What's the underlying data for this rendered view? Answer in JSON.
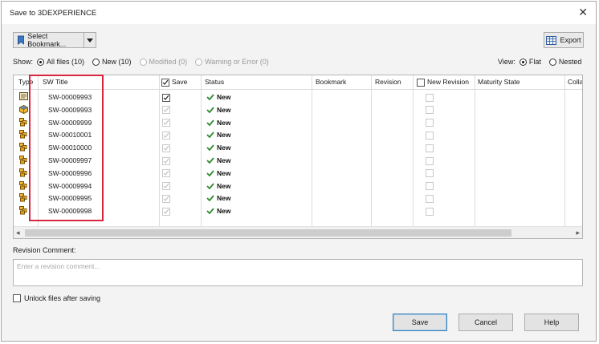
{
  "window": {
    "title": "Save to 3DEXPERIENCE",
    "close_glyph": "✕"
  },
  "toolbar": {
    "bookmark_label": "Select Bookmark...",
    "export_label": "Export"
  },
  "show_filter": {
    "label": "Show:",
    "options": [
      {
        "label": "All files (10)",
        "selected": true,
        "enabled": true
      },
      {
        "label": "New (10)",
        "selected": false,
        "enabled": true
      },
      {
        "label": "Modified (0)",
        "selected": false,
        "enabled": false
      },
      {
        "label": "Warning or Error (0)",
        "selected": false,
        "enabled": false
      }
    ]
  },
  "view_filter": {
    "label": "View:",
    "options": [
      {
        "label": "Flat",
        "selected": true
      },
      {
        "label": "Nested",
        "selected": false
      }
    ]
  },
  "grid": {
    "columns": [
      "Type",
      "SW Title",
      "Save",
      "Status",
      "Bookmark",
      "Revision",
      "New Revision",
      "Maturity State",
      "Colla"
    ],
    "rows": [
      {
        "icon": "drawing-icon",
        "title": "SW-00009993",
        "save_enabled": true,
        "status": "New"
      },
      {
        "icon": "part-icon",
        "title": "SW-00009993",
        "save_enabled": false,
        "status": "New"
      },
      {
        "icon": "assembly-icon",
        "title": "SW-00009999",
        "save_enabled": false,
        "status": "New"
      },
      {
        "icon": "assembly-icon",
        "title": "SW-00010001",
        "save_enabled": false,
        "status": "New"
      },
      {
        "icon": "assembly-icon",
        "title": "SW-00010000",
        "save_enabled": false,
        "status": "New"
      },
      {
        "icon": "assembly-icon",
        "title": "SW-00009997",
        "save_enabled": false,
        "status": "New"
      },
      {
        "icon": "assembly-icon",
        "title": "SW-00009996",
        "save_enabled": false,
        "status": "New"
      },
      {
        "icon": "assembly-icon",
        "title": "SW-00009994",
        "save_enabled": false,
        "status": "New"
      },
      {
        "icon": "assembly-icon",
        "title": "SW-00009995",
        "save_enabled": false,
        "status": "New"
      },
      {
        "icon": "assembly-icon",
        "title": "SW-00009998",
        "save_enabled": false,
        "status": "New"
      }
    ]
  },
  "revision": {
    "label": "Revision Comment:",
    "placeholder": "Enter a revision comment..."
  },
  "unlock_label": "Unlock files after saving",
  "buttons": {
    "save": "Save",
    "cancel": "Cancel",
    "help": "Help"
  },
  "colors": {
    "highlight_box": "#d7263d",
    "status_check": "#2e8b2e",
    "primary_border": "#3c7fb1"
  }
}
